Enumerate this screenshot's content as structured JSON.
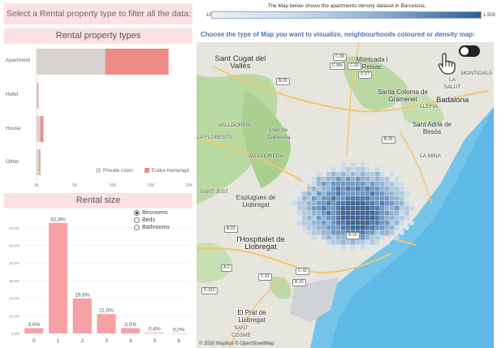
{
  "filter_title": "Select a Rental property type to filter all the data:",
  "property_types": {
    "title": "Rental property types",
    "categories": [
      "Apartment",
      "Hotel",
      "House",
      "Other"
    ],
    "legend": [
      {
        "label": "Private room",
        "color": "#d9d4d0"
      },
      {
        "label": "Entire home/apt",
        "color": "#ee8a86"
      }
    ],
    "axis_ticks": [
      "0K",
      "5K",
      "10K",
      "15K",
      "20K"
    ],
    "chart_data": {
      "type": "bar",
      "categories": [
        "Apartment",
        "Hotel",
        "House",
        "Other"
      ],
      "series": [
        {
          "name": "Private room",
          "values": [
            9000,
            150,
            500,
            350
          ]
        },
        {
          "name": "Entire home/apt",
          "values": [
            8300,
            100,
            400,
            150
          ]
        }
      ],
      "xlim": [
        0,
        20000
      ]
    }
  },
  "rental_size": {
    "title": "Rental size",
    "radio_options": [
      {
        "label": "Becrooms",
        "selected": true
      },
      {
        "label": "Beds",
        "selected": false
      },
      {
        "label": "Bathrooms",
        "selected": false
      }
    ],
    "y_ticks": [
      "0,0%",
      "10,0%",
      "20,0%",
      "30,0%",
      "40,0%",
      "50,0%",
      "60,0%"
    ],
    "chart_data": {
      "type": "bar",
      "categories": [
        "0",
        "1",
        "2",
        "3",
        "4",
        "5",
        "6"
      ],
      "values": [
        3.0,
        62.8,
        19.8,
        11.0,
        3.0,
        0.4,
        0.0
      ],
      "labels": [
        "3,0%",
        "62,8%",
        "19,8%",
        "11,0%",
        "3,0%",
        "0,4%",
        "0,0%"
      ],
      "ylim": [
        0,
        65
      ]
    }
  },
  "map": {
    "title": "The Map below shows the apartments density dataset in Barcelona.",
    "scale_min": "10",
    "scale_max": "1.500",
    "choose_text": "Choose the type of Map you want to visualize, neighbourhoods coloured or density map:",
    "attribution": "© 2020 Mapbox © OpenStreetMap",
    "places": {
      "p1": "Sant Cugat del Vallès",
      "p2": "Montcada i Reixac",
      "p3": "Santa Coloma de Gramenet",
      "p4": "Badalona",
      "p5": "Sant Adrià de Besòs",
      "p6": "Esplugues de Llobregat",
      "p7": "l'Hospitalet de Llobregat",
      "p8": "El Prat de Llobregat",
      "p9": "SANT COSME",
      "p10": "Parc de Collserola",
      "p11": "VALLDOREIX",
      "p12": "LA FLORESTA",
      "p13": "VALLVIDRERA",
      "p14": "LA MINA",
      "p15": "LLEFIA",
      "p16": "LA SALUT",
      "p17": "SANT JUST",
      "p18": "MONTIGALÀ"
    },
    "roads": {
      "r1": "C-58",
      "r2": "C-33",
      "r3": "C-58c",
      "r4": "C-17",
      "r5": "B-20",
      "r6": "B-23",
      "r7": "B-10",
      "r8": "C-32",
      "r9": "C-31",
      "r10": "B-10",
      "r11": "C-31C",
      "r12": "A-2",
      "r13": "B-20"
    }
  }
}
